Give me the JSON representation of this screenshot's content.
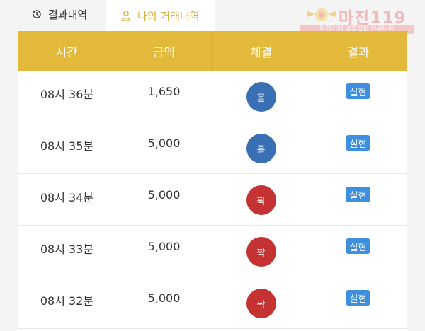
{
  "tabs": [
    {
      "label": "결과내역",
      "icon": "history-icon",
      "active": false
    },
    {
      "label": "나의 거래내역",
      "icon": "user-icon",
      "active": true
    }
  ],
  "watermark": {
    "text": "마진119",
    "subtitle": "마진거래 검증전문 커뮤니티"
  },
  "colors": {
    "header": "#e3b93b",
    "odd": "#3a6fb3",
    "even": "#c43232",
    "badge": "#3e8fe0",
    "active_tab": "#d8b13a"
  },
  "table": {
    "headers": [
      "시간",
      "금액",
      "체결",
      "결과"
    ],
    "rows": [
      {
        "time": "08시 36분",
        "amount": "1,650",
        "fill": "홀",
        "fill_type": "odd",
        "result": "실현"
      },
      {
        "time": "08시 35분",
        "amount": "5,000",
        "fill": "홀",
        "fill_type": "odd",
        "result": "실현"
      },
      {
        "time": "08시 34분",
        "amount": "5,000",
        "fill": "짝",
        "fill_type": "even",
        "result": "실현"
      },
      {
        "time": "08시 33분",
        "amount": "5,000",
        "fill": "짝",
        "fill_type": "even",
        "result": "실현"
      },
      {
        "time": "08시 32분",
        "amount": "5,000",
        "fill": "짝",
        "fill_type": "even",
        "result": "실현"
      }
    ]
  }
}
